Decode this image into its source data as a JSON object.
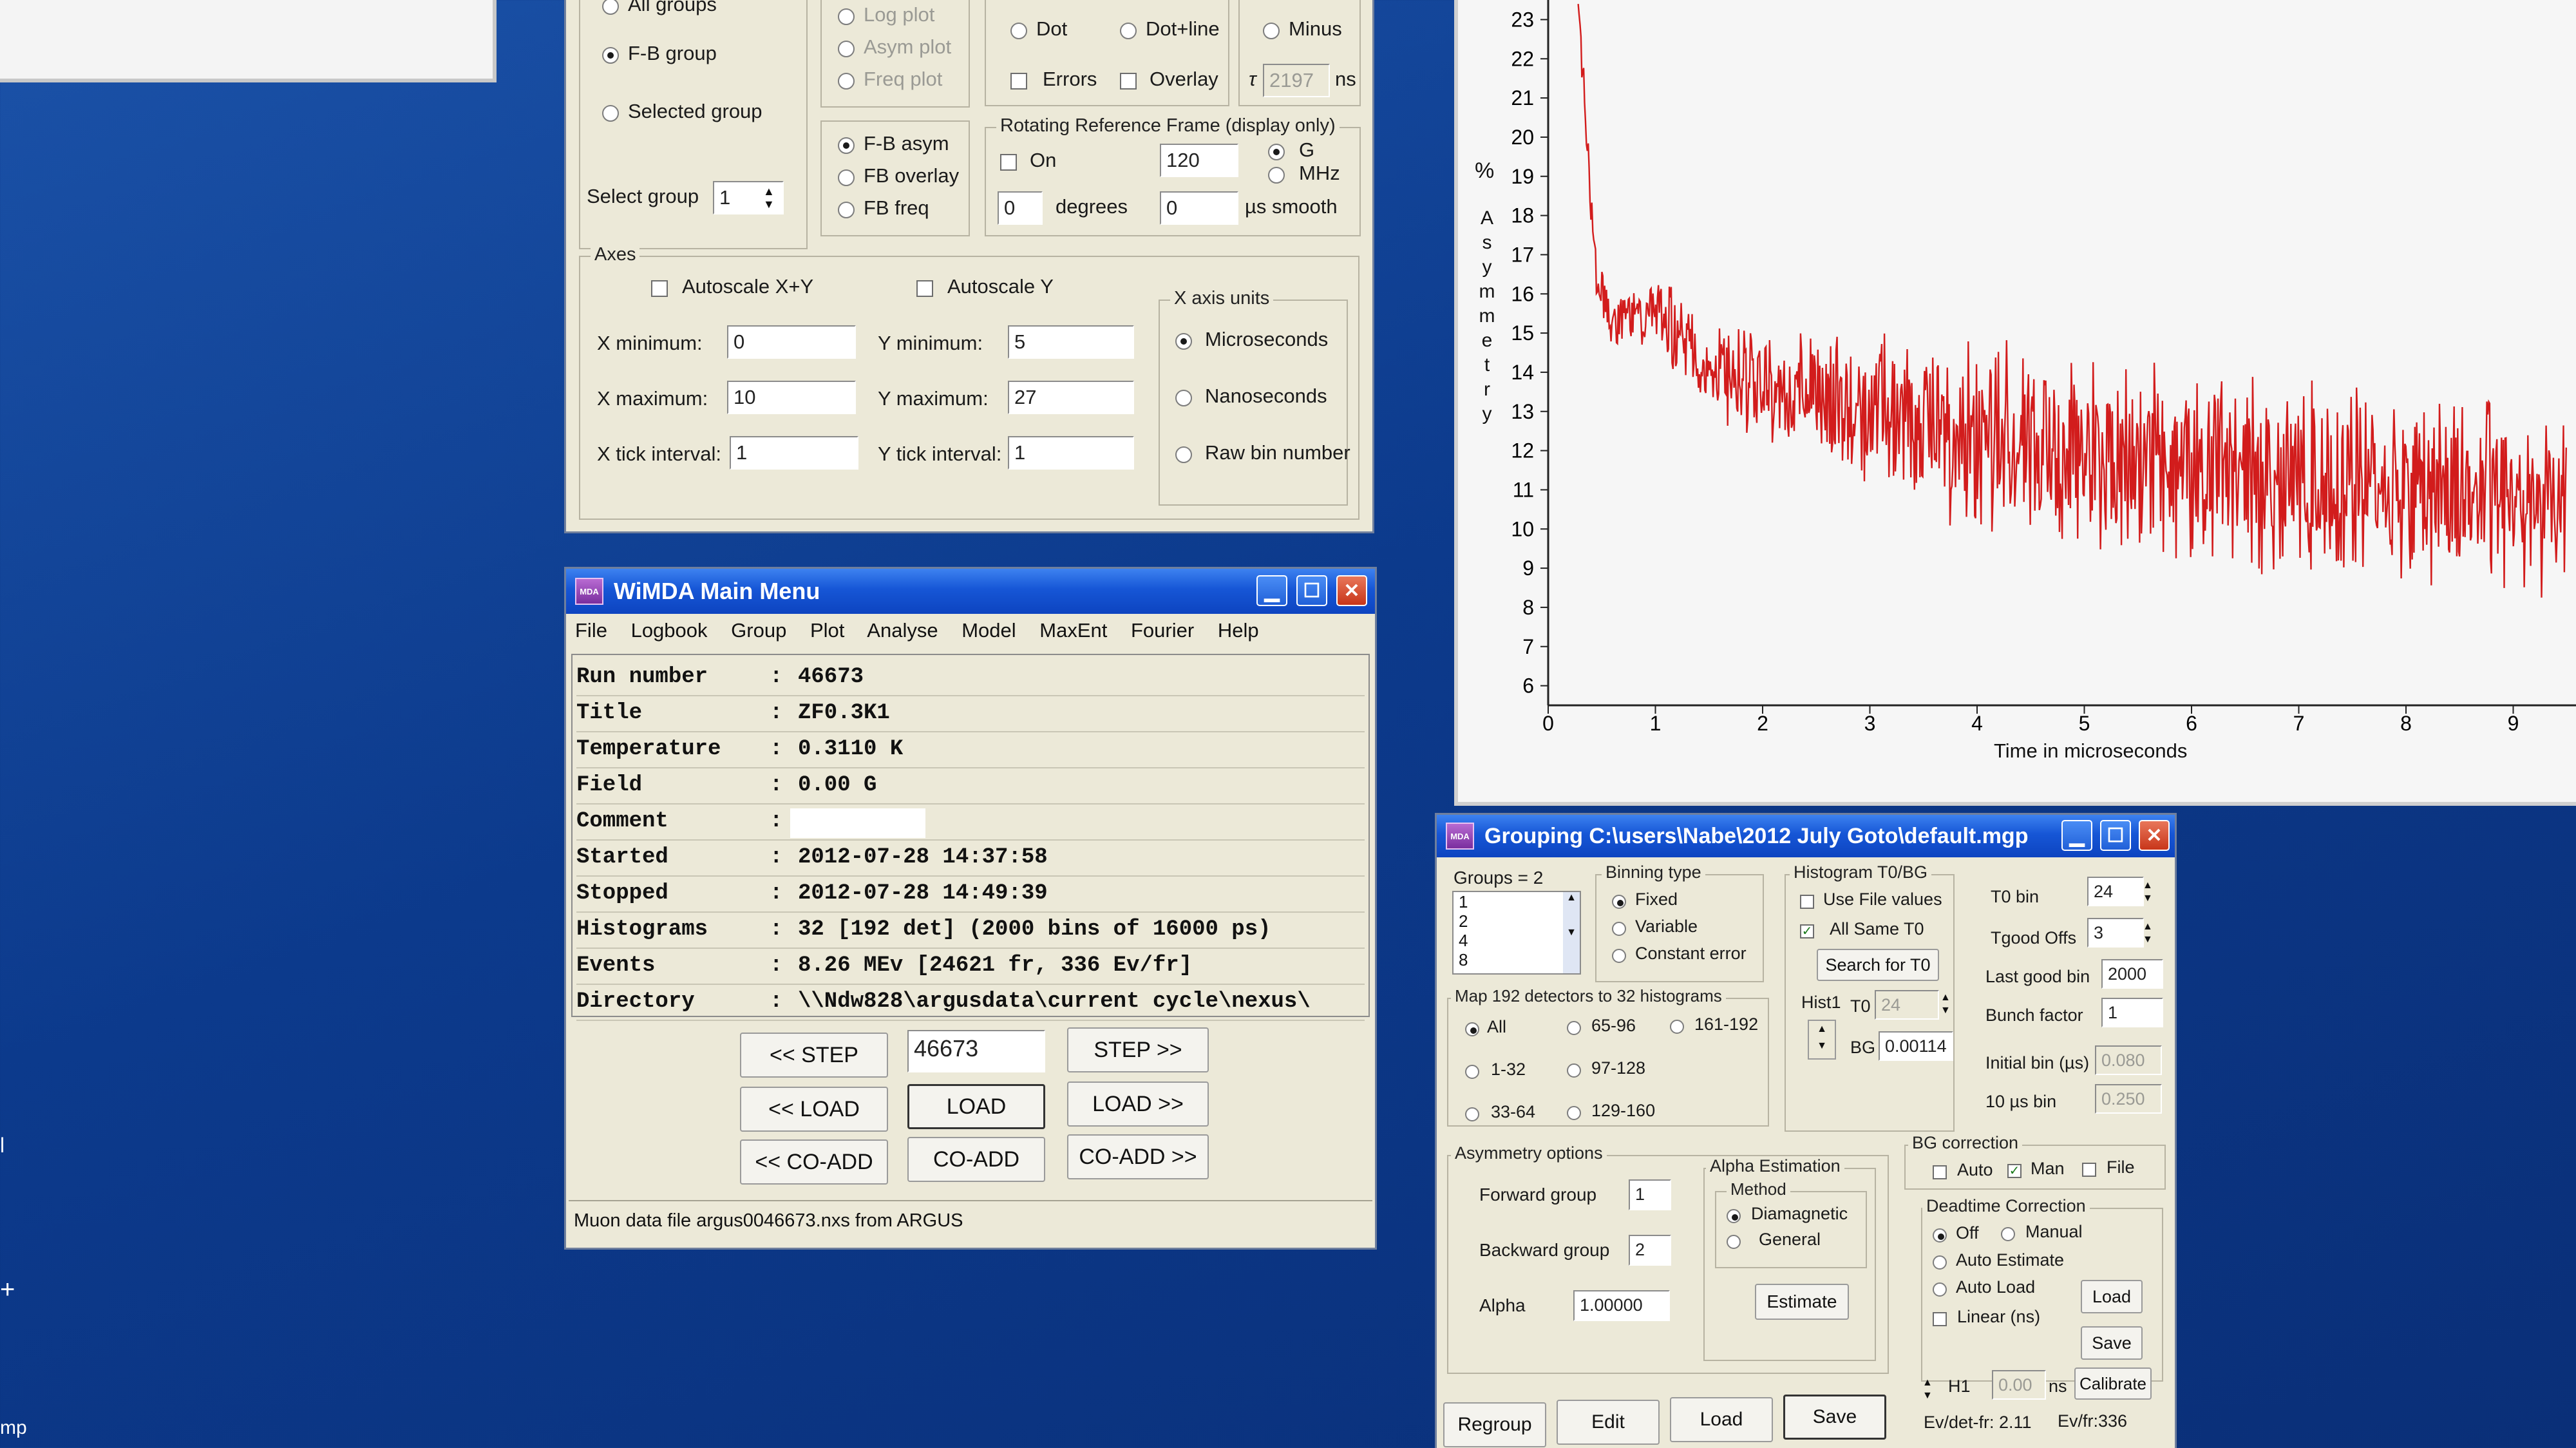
{
  "plot_options": {
    "all_groups": "All groups",
    "fb_group": "F-B group",
    "selected_group": "Selected group",
    "select_group_label": "Select group",
    "select_group_value": "1",
    "log_plot": "Log plot",
    "asym_plot": "Asym plot",
    "freq_plot": "Freq plot",
    "fb_asym": "F-B asym",
    "fb_overlay": "FB overlay",
    "fb_freq": "FB freq",
    "dot": "Dot",
    "dot_line": "Dot+line",
    "minus": "Minus",
    "errors": "Errors",
    "overlay": "Overlay",
    "tau_symbol": "τ",
    "tau_value": "2197",
    "ns": "ns",
    "rrf_title": "Rotating Reference Frame (display only)",
    "rrf_on": "On",
    "rrf_field": "120",
    "rrf_g": "G",
    "rrf_mhz": "MHz",
    "rrf_phase": "0",
    "degrees": "degrees",
    "smooth_value": "0",
    "smooth_label": "µs smooth"
  },
  "axes": {
    "title": "Axes",
    "autoscale_xy": "Autoscale X+Y",
    "autoscale_y": "Autoscale Y",
    "x_minimum_label": "X minimum:",
    "x_minimum": "0",
    "x_maximum_label": "X maximum:",
    "x_maximum": "10",
    "x_tick_label": "X tick interval:",
    "x_tick": "1",
    "y_minimum_label": "Y minimum:",
    "y_minimum": "5",
    "y_maximum_label": "Y maximum:",
    "y_maximum": "27",
    "y_tick_label": "Y tick interval:",
    "y_tick": "1",
    "units_title": "X axis units",
    "microseconds": "Microseconds",
    "nanoseconds": "Nanoseconds",
    "raw_bin": "Raw bin number"
  },
  "main_menu": {
    "title": "WiMDA Main Menu",
    "app_icon": "MDA",
    "menus": [
      "File",
      "Logbook",
      "Group",
      "Plot",
      "Analyse",
      "Model",
      "MaxEnt",
      "Fourier",
      "Help"
    ],
    "info": [
      {
        "key": "Run number",
        "value": "46673"
      },
      {
        "key": "Title",
        "value": "ZF0.3K1"
      },
      {
        "key": "Temperature",
        "value": "0.3110 K"
      },
      {
        "key": "Field",
        "value": "0.00 G"
      },
      {
        "key": "Comment",
        "value": ""
      },
      {
        "key": "Started",
        "value": "2012-07-28   14:37:58"
      },
      {
        "key": "Stopped",
        "value": "2012-07-28   14:49:39"
      },
      {
        "key": "Histograms",
        "value": "32 [192 det] (2000 bins of 16000 ps)"
      },
      {
        "key": "Events",
        "value": "8.26 MEv [24621 fr, 336 Ev/fr]"
      },
      {
        "key": "Directory",
        "value": "\\\\Ndw828\\argusdata\\current cycle\\nexus\\"
      }
    ],
    "step_back": "<< STEP",
    "run_input": "46673",
    "step_fwd": "STEP >>",
    "load_back": "<< LOAD",
    "load": "LOAD",
    "load_fwd": "LOAD >>",
    "coadd_back": "<< CO-ADD",
    "coadd": "CO-ADD",
    "coadd_fwd": "CO-ADD >>",
    "status": "Muon data file argus0046673.nxs from ARGUS"
  },
  "chart_data": {
    "type": "line",
    "xlabel": "Time in microseconds",
    "ylabel": "Asymmetry",
    "ylabel_unit": "%",
    "xlim": [
      0,
      9.5
    ],
    "ylim": [
      5.5,
      23.5
    ],
    "x_ticks": [
      "0",
      "1",
      "2",
      "3",
      "4",
      "5",
      "6",
      "7",
      "8",
      "9"
    ],
    "y_ticks": [
      "6",
      "7",
      "8",
      "9",
      "10",
      "11",
      "12",
      "13",
      "14",
      "15",
      "16",
      "17",
      "18",
      "19",
      "20",
      "21",
      "22",
      "23"
    ],
    "series": [
      {
        "color": "#d21c1c",
        "trend": {
          "x": [
            0.28,
            0.33,
            0.38,
            0.45,
            0.6,
            0.8,
            1.0,
            1.5,
            2.0,
            3.0,
            4.0,
            5.0,
            6.0,
            7.0,
            8.0,
            9.0,
            9.5
          ],
          "y": [
            23.5,
            21.5,
            19.0,
            16.5,
            15.3,
            15.4,
            15.5,
            14.2,
            13.6,
            13.0,
            12.4,
            12.0,
            11.6,
            11.3,
            11.1,
            10.9,
            10.8
          ]
        },
        "noise_amplitude": 3.2
      }
    ]
  },
  "grouping": {
    "title": "Grouping C:\\users\\Nabe\\2012 July Goto\\default.mgp",
    "app_icon": "MDA",
    "groups_label": "Groups = 2",
    "groups_list": [
      "1",
      "2",
      "4",
      "8"
    ],
    "binning_title": "Binning type",
    "fixed": "Fixed",
    "variable": "Variable",
    "constant_error": "Constant error",
    "map_title": "Map 192 detectors to 32 histograms",
    "map_all": "All",
    "map_65_96": "65-96",
    "map_161_192": "161-192",
    "map_1_32": "1-32",
    "map_97_128": "97-128",
    "map_33_64": "33-64",
    "map_129_160": "129-160",
    "hist_title": "Histogram T0/BG",
    "use_file_values": "Use File values",
    "all_same_t0": "All Same T0",
    "search_t0": "Search for T0",
    "hist1": "Hist1",
    "t0_label": "T0",
    "t0_value": "24",
    "bg_label": "BG",
    "bg_value": "0.00114",
    "t0_bin_label": "T0 bin",
    "t0_bin": "24",
    "tgood_label": "Tgood Offs",
    "tgood": "3",
    "last_good_label": "Last good bin",
    "last_good": "2000",
    "bunch_label": "Bunch factor",
    "bunch": "1",
    "initial_bin_label": "Initial bin (µs)",
    "initial_bin": "0.080",
    "ten_us_label": "10 µs bin",
    "ten_us": "0.250",
    "asym_title": "Asymmetry options",
    "forward_label": "Forward group",
    "forward": "1",
    "backward_label": "Backward group",
    "backward": "2",
    "alpha_label": "Alpha",
    "alpha": "1.00000",
    "alpha_est_title": "Alpha Estimation",
    "method_title": "Method",
    "diamagnetic": "Diamagnetic",
    "general": "General",
    "estimate": "Estimate",
    "bg_corr_title": "BG correction",
    "bg_auto": "Auto",
    "bg_man": "Man",
    "bg_file": "File",
    "deadtime_title": "Deadtime Correction",
    "dt_off": "Off",
    "dt_manual": "Manual",
    "dt_auto_estimate": "Auto Estimate",
    "dt_auto_load": "Auto Load",
    "dt_linear": "Linear (ns)",
    "dt_load": "Load",
    "dt_save": "Save",
    "h1_label": "H1",
    "h1_value": "0.00",
    "h1_unit": "ns",
    "calibrate": "Calibrate",
    "ev_det": "Ev/det-fr: 2.11",
    "ev_fr": "Ev/fr:336",
    "regroup": "Regroup",
    "edit": "Edit",
    "load": "Load",
    "save": "Save"
  },
  "desktop": {
    "left_label": "mp",
    "left_plus": "+",
    "left_l": "l"
  }
}
